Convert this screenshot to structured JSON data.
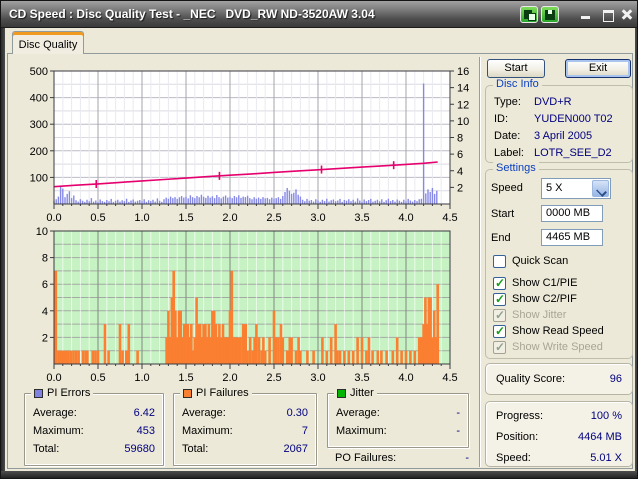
{
  "window": {
    "title": "CD Speed : Disc Quality Test - _NEC   DVD_RW ND-3520AW 3.04",
    "titlebar_icons": [
      "screenshot-icon",
      "save-icon"
    ],
    "window_controls": [
      "minimize",
      "maximize",
      "close"
    ]
  },
  "tab": {
    "label": "Disc Quality"
  },
  "actions": {
    "start": "Start",
    "exit": "Exit"
  },
  "disc_info": {
    "title": "Disc Info",
    "rows": [
      {
        "label": "Type:",
        "value": "DVD+R"
      },
      {
        "label": "ID:",
        "value": "YUDEN000 T02"
      },
      {
        "label": "Date:",
        "value": "3 April 2005"
      },
      {
        "label": "Label:",
        "value": "LOTR_SEE_D2"
      }
    ]
  },
  "settings": {
    "title": "Settings",
    "speed": {
      "label": "Speed",
      "value": "5 X"
    },
    "start": {
      "label": "Start",
      "value": "0000 MB"
    },
    "end": {
      "label": "End",
      "value": "4465 MB"
    },
    "checkboxes": [
      {
        "label": "Quick Scan",
        "checked": false,
        "enabled": true
      },
      {
        "label": "Show C1/PIE",
        "checked": true,
        "enabled": true
      },
      {
        "label": "Show C2/PIF",
        "checked": true,
        "enabled": true
      },
      {
        "label": "Show Jitter",
        "checked": true,
        "enabled": false
      },
      {
        "label": "Show Read Speed",
        "checked": true,
        "enabled": true
      },
      {
        "label": "Show Write Speed",
        "checked": true,
        "enabled": false
      }
    ]
  },
  "quality_score": {
    "label": "Quality Score:",
    "value": "96"
  },
  "status": {
    "rows": [
      {
        "label": "Progress:",
        "value": "100 %"
      },
      {
        "label": "Position:",
        "value": "4464 MB"
      },
      {
        "label": "Speed:",
        "value": "5.01 X"
      }
    ]
  },
  "stats": {
    "pi_errors": {
      "title": "PI Errors",
      "color": "#8082e0",
      "rows": [
        {
          "label": "Average:",
          "value": "6.42"
        },
        {
          "label": "Maximum:",
          "value": "453"
        },
        {
          "label": "Total:",
          "value": "59680"
        }
      ]
    },
    "pi_failures": {
      "title": "PI Failures",
      "color": "#fb7f31",
      "rows": [
        {
          "label": "Average:",
          "value": "0.30"
        },
        {
          "label": "Maximum:",
          "value": "7"
        },
        {
          "label": "Total:",
          "value": "2067"
        }
      ]
    },
    "jitter": {
      "title": "Jitter",
      "color": "#00b400",
      "rows": [
        {
          "label": "Average:",
          "value": "-"
        },
        {
          "label": "Maximum:",
          "value": "-"
        }
      ]
    },
    "po_failures": {
      "label": "PO Failures:",
      "value": "-"
    }
  },
  "chart_data": [
    {
      "type": "bar",
      "name": "pi-errors-and-read-speed",
      "xlim": [
        0,
        4.5
      ],
      "ylim_left": [
        0,
        500
      ],
      "ylim_right": [
        0,
        16
      ],
      "x_tick_labels": [
        "0.0",
        "0.5",
        "1.0",
        "1.5",
        "2.0",
        "2.5",
        "3.0",
        "3.5",
        "4.0",
        "4.5"
      ],
      "left_tick_labels": [
        100,
        200,
        300,
        400,
        500
      ],
      "right_tick_labels": [
        2,
        4,
        6,
        8,
        10,
        12,
        14,
        16
      ],
      "grid": true,
      "pie_color": "#8688e6",
      "speed_color": "#e6006e",
      "pie_dx": 0.025,
      "pie": [
        12,
        18,
        28,
        65,
        58,
        25,
        38,
        48,
        22,
        32,
        14,
        9,
        18,
        12,
        8,
        16,
        10,
        22,
        9,
        13,
        7,
        17,
        11,
        8,
        15,
        10,
        19,
        8,
        12,
        16,
        9,
        14,
        11,
        20,
        8,
        13,
        17,
        9,
        12,
        15,
        10,
        18,
        8,
        14,
        11,
        16,
        9,
        21,
        12,
        8,
        18,
        24,
        20,
        28,
        22,
        26,
        19,
        25,
        30,
        24,
        28,
        21,
        33,
        26,
        22,
        30,
        25,
        35,
        27,
        23,
        31,
        24,
        29,
        22,
        34,
        26,
        21,
        28,
        32,
        24,
        27,
        22,
        30,
        25,
        33,
        23,
        28,
        26,
        31,
        22,
        18,
        25,
        20,
        24,
        19,
        26,
        21,
        23,
        18,
        24,
        20,
        22,
        25,
        19,
        30,
        45,
        60,
        50,
        38,
        42,
        55,
        35,
        28,
        16,
        10,
        19,
        12,
        15,
        9,
        18,
        13,
        8,
        16,
        11,
        20,
        9,
        14,
        17,
        10,
        13,
        19,
        8,
        15,
        12,
        18,
        10,
        16,
        9,
        21,
        13,
        8,
        17,
        11,
        15,
        19,
        9,
        12,
        16,
        10,
        18,
        8,
        14,
        20,
        11,
        15,
        9,
        17,
        12,
        8,
        16,
        10,
        19,
        13,
        9,
        15,
        11,
        18,
        20,
        453,
        40,
        55,
        45,
        60,
        38,
        50
      ],
      "speed_line": [
        [
          0,
          2.08
        ],
        [
          0.25,
          2.26
        ],
        [
          0.5,
          2.42
        ],
        [
          0.75,
          2.6
        ],
        [
          1,
          2.78
        ],
        [
          1.25,
          2.95
        ],
        [
          1.5,
          3.12
        ],
        [
          1.75,
          3.3
        ],
        [
          2,
          3.46
        ],
        [
          2.25,
          3.62
        ],
        [
          2.5,
          3.8
        ],
        [
          2.75,
          3.96
        ],
        [
          3,
          4.12
        ],
        [
          3.25,
          4.28
        ],
        [
          3.5,
          4.44
        ],
        [
          3.75,
          4.6
        ],
        [
          4,
          4.76
        ],
        [
          4.2,
          4.9
        ],
        [
          4.36,
          5.05
        ]
      ],
      "speed_marks": [
        0.48,
        1.88,
        3.04,
        3.86
      ]
    },
    {
      "type": "bar",
      "name": "pi-failures",
      "xlim": [
        0,
        4.5
      ],
      "ylim": [
        0,
        10
      ],
      "x_tick_labels": [
        "0.0",
        "0.5",
        "1.0",
        "1.5",
        "2.0",
        "2.5",
        "3.0",
        "3.5",
        "4.0",
        "4.5"
      ],
      "left_tick_labels": [
        2,
        4,
        6,
        8,
        10
      ],
      "grid": true,
      "bg_color": "#c7f2c3",
      "bar_color": "#fb7f31",
      "bars": [
        [
          0.02,
          7
        ],
        [
          0.05,
          1
        ],
        [
          0.07,
          1
        ],
        [
          0.09,
          1
        ],
        [
          0.11,
          1
        ],
        [
          0.14,
          1
        ],
        [
          0.16,
          1
        ],
        [
          0.19,
          1
        ],
        [
          0.22,
          1
        ],
        [
          0.25,
          1
        ],
        [
          0.28,
          1
        ],
        [
          0.33,
          1
        ],
        [
          0.36,
          1
        ],
        [
          0.38,
          1
        ],
        [
          0.44,
          1
        ],
        [
          0.47,
          1
        ],
        [
          0.5,
          1
        ],
        [
          0.58,
          3
        ],
        [
          0.62,
          1
        ],
        [
          0.75,
          3
        ],
        [
          0.78,
          1
        ],
        [
          0.82,
          1
        ],
        [
          0.85,
          3
        ],
        [
          0.95,
          1
        ],
        [
          1.28,
          2
        ],
        [
          1.3,
          4
        ],
        [
          1.32,
          2
        ],
        [
          1.34,
          5
        ],
        [
          1.36,
          7
        ],
        [
          1.38,
          4
        ],
        [
          1.4,
          2
        ],
        [
          1.42,
          4
        ],
        [
          1.44,
          4
        ],
        [
          1.46,
          2
        ],
        [
          1.48,
          3
        ],
        [
          1.5,
          3
        ],
        [
          1.52,
          3
        ],
        [
          1.54,
          2
        ],
        [
          1.56,
          3
        ],
        [
          1.58,
          1
        ],
        [
          1.6,
          2
        ],
        [
          1.62,
          5
        ],
        [
          1.64,
          3
        ],
        [
          1.66,
          3
        ],
        [
          1.68,
          2
        ],
        [
          1.7,
          3
        ],
        [
          1.72,
          3
        ],
        [
          1.74,
          2
        ],
        [
          1.76,
          3
        ],
        [
          1.78,
          2
        ],
        [
          1.8,
          4
        ],
        [
          1.82,
          4
        ],
        [
          1.84,
          3
        ],
        [
          1.86,
          2
        ],
        [
          1.88,
          3
        ],
        [
          1.9,
          2
        ],
        [
          1.92,
          3
        ],
        [
          1.94,
          2
        ],
        [
          1.96,
          2
        ],
        [
          1.98,
          2
        ],
        [
          2,
          4
        ],
        [
          2.02,
          7
        ],
        [
          2.04,
          2
        ],
        [
          2.06,
          2
        ],
        [
          2.08,
          2
        ],
        [
          2.1,
          2
        ],
        [
          2.12,
          2
        ],
        [
          2.15,
          3
        ],
        [
          2.18,
          3
        ],
        [
          2.2,
          1
        ],
        [
          2.23,
          2
        ],
        [
          2.26,
          1
        ],
        [
          2.28,
          2
        ],
        [
          2.3,
          3
        ],
        [
          2.33,
          2
        ],
        [
          2.36,
          1
        ],
        [
          2.38,
          2
        ],
        [
          2.4,
          1
        ],
        [
          2.45,
          2
        ],
        [
          2.5,
          4
        ],
        [
          2.52,
          2
        ],
        [
          2.55,
          2
        ],
        [
          2.58,
          3
        ],
        [
          2.6,
          2
        ],
        [
          2.65,
          1
        ],
        [
          2.68,
          2
        ],
        [
          2.7,
          2
        ],
        [
          2.75,
          1
        ],
        [
          2.78,
          2
        ],
        [
          2.8,
          1
        ],
        [
          2.88,
          1
        ],
        [
          2.95,
          1
        ],
        [
          3.05,
          2
        ],
        [
          3.1,
          1
        ],
        [
          3.15,
          2
        ],
        [
          3.2,
          3
        ],
        [
          3.22,
          1
        ],
        [
          3.25,
          1
        ],
        [
          3.3,
          1
        ],
        [
          3.35,
          1
        ],
        [
          3.4,
          1
        ],
        [
          3.45,
          2
        ],
        [
          3.5,
          2
        ],
        [
          3.55,
          1
        ],
        [
          3.58,
          2
        ],
        [
          3.62,
          1
        ],
        [
          3.68,
          1
        ],
        [
          3.72,
          1
        ],
        [
          3.78,
          1
        ],
        [
          3.85,
          1
        ],
        [
          3.9,
          2
        ],
        [
          3.95,
          1
        ],
        [
          4,
          1
        ],
        [
          4.05,
          1
        ],
        [
          4.1,
          1
        ],
        [
          4.15,
          2
        ],
        [
          4.18,
          2
        ],
        [
          4.2,
          3
        ],
        [
          4.22,
          5
        ],
        [
          4.24,
          3
        ],
        [
          4.26,
          5
        ],
        [
          4.28,
          5
        ],
        [
          4.3,
          2
        ],
        [
          4.32,
          4
        ],
        [
          4.34,
          2
        ],
        [
          4.36,
          6
        ]
      ]
    }
  ]
}
